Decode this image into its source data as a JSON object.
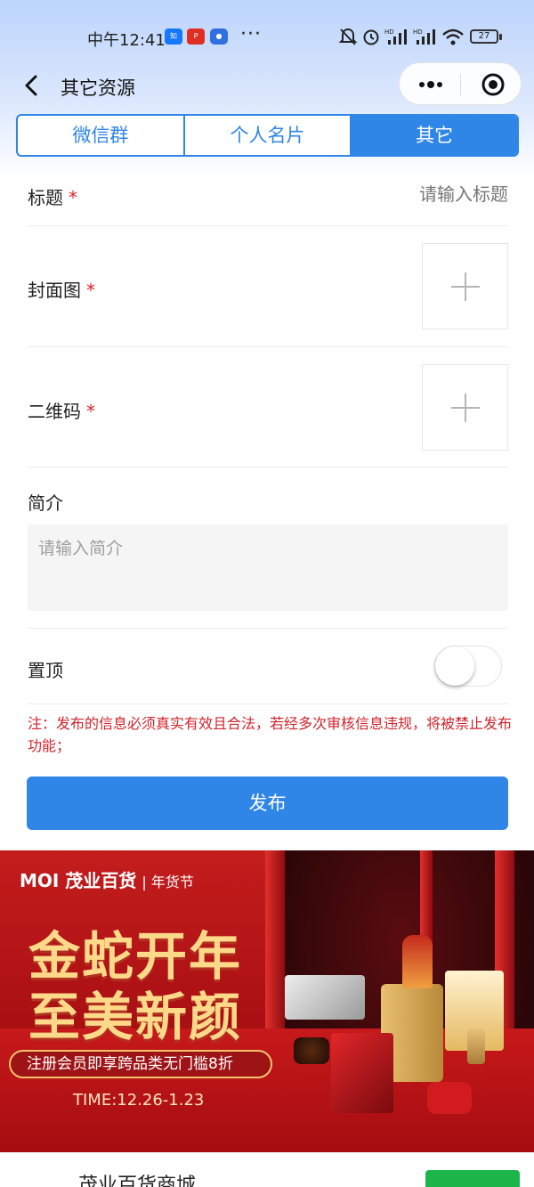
{
  "status_bar": {
    "time": "中午12:41",
    "app_icons": [
      "zhihu-icon",
      "pinduoduo-icon",
      "app-icon"
    ],
    "more": "···",
    "battery": "27"
  },
  "nav": {
    "title": "其它资源"
  },
  "tabs": [
    {
      "label": "微信群",
      "active": false
    },
    {
      "label": "个人名片",
      "active": false
    },
    {
      "label": "其它",
      "active": true
    }
  ],
  "form": {
    "title_label": "标题",
    "title_placeholder": "请输入标题",
    "cover_label": "封面图",
    "qrcode_label": "二维码",
    "intro_label": "简介",
    "intro_placeholder": "请输入简介",
    "pin_label": "置顶",
    "pin_on": false,
    "required_mark": "*"
  },
  "note": "注：发布的信息必须真实有效且合法，若经多次审核信息违规，将被禁止发布功能；",
  "publish_button": "发布",
  "banner": {
    "logo": "MOI 茂业百货",
    "logo_tag": "| 年货节",
    "headline_1": "金蛇开年",
    "headline_2": "至美新颜",
    "promo": "注册会员即享跨品类无门槛8折",
    "time": "TIME:12.26-1.23"
  },
  "bottom": {
    "store_name": "茂业百货商城"
  },
  "colors": {
    "accent": "#2f86e6",
    "required": "#e0232b",
    "note": "#d0242c"
  }
}
